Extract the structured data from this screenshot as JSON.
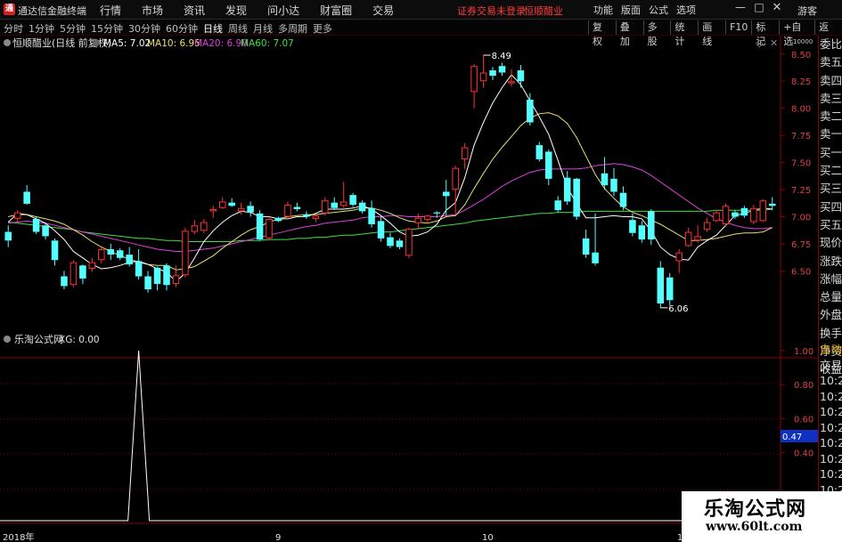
{
  "app": {
    "logo": "通",
    "title": "通达信金融终端",
    "notice": "证券交易未登录",
    "stock_name": "恒顺醋业",
    "guest": "游客"
  },
  "main_menu": [
    "行情",
    "市场",
    "资讯",
    "发现",
    "问小达",
    "财富圈",
    "交易"
  ],
  "right_menu": [
    "功能",
    "版面",
    "公式",
    "选项"
  ],
  "period_tabs": [
    {
      "label": "分时",
      "active": false
    },
    {
      "label": "1分钟",
      "active": false
    },
    {
      "label": "5分钟",
      "active": false
    },
    {
      "label": "15分钟",
      "active": false
    },
    {
      "label": "30分钟",
      "active": false
    },
    {
      "label": "60分钟",
      "active": false
    },
    {
      "label": "日线",
      "active": true
    },
    {
      "label": "周线",
      "active": false
    },
    {
      "label": "月线",
      "active": false
    },
    {
      "label": "多周期",
      "active": false
    },
    {
      "label": "更多",
      "active": false
    }
  ],
  "tool_buttons": [
    "复权",
    "叠加",
    "多股",
    "统计",
    "画线",
    "F10",
    "标记",
    "+自选",
    "返回"
  ],
  "main_panel": {
    "title": "恒顺醋业(日线 前复权)",
    "ma_legend": [
      {
        "label": "MA5: 7.02",
        "color": "#ffffff"
      },
      {
        "label": "MA10: 6.95",
        "color": "#e8e070"
      },
      {
        "label": "MA20: 6.90",
        "color": "#e040e0"
      },
      {
        "label": "MA60: 7.07",
        "color": "#40e040"
      }
    ],
    "y_ticks": [
      "8.50",
      "8.25",
      "8.00",
      "7.75",
      "7.50",
      "7.25",
      "7.00",
      "6.75",
      "6.50"
    ],
    "high_label": "8.49",
    "low_label": "6.06",
    "top_scale": "10000"
  },
  "sub_panel": {
    "title": "乐淘公式网",
    "value_label": "XG: 0.00",
    "y_ticks": [
      "1.00",
      "0.80",
      "0.60",
      "0.40"
    ],
    "cursor_value": "0.47"
  },
  "x_axis": [
    "2018年",
    "9",
    "10",
    "1"
  ],
  "quote_labels": [
    "委比",
    "卖五",
    "卖四",
    "卖三",
    "卖二",
    "卖一",
    "买一",
    "买二",
    "买三",
    "买四",
    "买五",
    "现价",
    "涨跌",
    "涨幅",
    "总量",
    "外盘",
    "换手",
    "净资",
    "收益"
  ],
  "sub_labels": [
    "自动",
    "交易",
    "10:2",
    "10:2",
    "10:2",
    "10:2",
    "10:2",
    "10:2",
    "10:2",
    "10:2",
    "10:2",
    "10:2"
  ],
  "watermark": {
    "title": "乐淘公式网",
    "url": "www.60lt.com"
  },
  "colors": {
    "up": "#ff3232",
    "down": "#54ffff",
    "grid": "#8b0000",
    "ma5": "#ffffff",
    "ma10": "#e8e070",
    "ma20": "#e040e0",
    "ma60": "#40e040",
    "signal": "#ffffff"
  },
  "chart_data": {
    "type": "candlestick",
    "candles": [
      [
        6.86,
        6.92,
        6.72,
        6.78
      ],
      [
        6.98,
        7.06,
        6.94,
        7.04
      ],
      [
        7.23,
        7.29,
        7.11,
        7.12
      ],
      [
        6.98,
        7.0,
        6.84,
        6.86
      ],
      [
        6.92,
        6.94,
        6.79,
        6.82
      ],
      [
        6.78,
        6.8,
        6.55,
        6.6
      ],
      [
        6.45,
        6.5,
        6.33,
        6.36
      ],
      [
        6.37,
        6.6,
        6.35,
        6.58
      ],
      [
        6.55,
        6.56,
        6.38,
        6.43
      ],
      [
        6.52,
        6.62,
        6.49,
        6.58
      ],
      [
        6.6,
        6.72,
        6.57,
        6.7
      ],
      [
        6.7,
        6.75,
        6.6,
        6.65
      ],
      [
        6.69,
        6.71,
        6.6,
        6.62
      ],
      [
        6.65,
        6.72,
        6.54,
        6.56
      ],
      [
        6.59,
        6.7,
        6.42,
        6.45
      ],
      [
        6.45,
        6.5,
        6.3,
        6.33
      ],
      [
        6.53,
        6.54,
        6.32,
        6.38
      ],
      [
        6.55,
        6.57,
        6.32,
        6.37
      ],
      [
        6.38,
        6.55,
        6.35,
        6.46
      ],
      [
        6.46,
        6.9,
        6.44,
        6.87
      ],
      [
        6.86,
        6.97,
        6.84,
        6.92
      ],
      [
        6.87,
        6.98,
        6.85,
        6.95
      ],
      [
        7.05,
        7.1,
        6.99,
        7.07
      ],
      [
        7.08,
        7.18,
        7.07,
        7.14
      ],
      [
        7.13,
        7.17,
        7.09,
        7.1
      ],
      [
        7.05,
        7.13,
        7.02,
        7.08
      ],
      [
        7.1,
        7.14,
        7.0,
        7.04
      ],
      [
        7.03,
        7.06,
        6.78,
        6.79
      ],
      [
        6.8,
        6.99,
        6.78,
        6.98
      ],
      [
        6.99,
        7.0,
        6.95,
        6.96
      ],
      [
        7.0,
        7.14,
        6.98,
        7.11
      ],
      [
        7.09,
        7.13,
        7.05,
        7.07
      ],
      [
        7.02,
        7.05,
        6.98,
        7.0
      ],
      [
        6.98,
        7.02,
        6.95,
        7.01
      ],
      [
        7.03,
        7.18,
        7.01,
        7.15
      ],
      [
        7.13,
        7.18,
        7.06,
        7.08
      ],
      [
        7.1,
        7.32,
        7.08,
        7.14
      ],
      [
        7.2,
        7.22,
        7.09,
        7.11
      ],
      [
        7.13,
        7.15,
        7.03,
        7.05
      ],
      [
        7.08,
        7.15,
        6.9,
        6.93
      ],
      [
        6.96,
        7.0,
        6.77,
        6.8
      ],
      [
        6.81,
        6.85,
        6.71,
        6.73
      ],
      [
        6.78,
        6.8,
        6.7,
        6.72
      ],
      [
        6.64,
        6.9,
        6.62,
        6.89
      ],
      [
        6.94,
        7.03,
        6.88,
        6.99
      ],
      [
        6.97,
        7.02,
        6.95,
        7.01
      ],
      [
        7.04,
        7.05,
        6.99,
        7.03
      ],
      [
        7.23,
        7.34,
        7.01,
        7.19
      ],
      [
        7.25,
        7.47,
        7.03,
        7.45
      ],
      [
        7.53,
        7.68,
        7.44,
        7.64
      ],
      [
        8.15,
        8.41,
        8.0,
        8.39
      ],
      [
        8.25,
        8.49,
        8.19,
        8.33
      ],
      [
        8.35,
        8.38,
        8.26,
        8.3
      ],
      [
        8.39,
        8.42,
        8.3,
        8.33
      ],
      [
        8.23,
        8.36,
        8.2,
        8.25
      ],
      [
        8.35,
        8.4,
        8.19,
        8.25
      ],
      [
        8.08,
        8.14,
        7.84,
        7.87
      ],
      [
        7.66,
        7.69,
        7.51,
        7.53
      ],
      [
        7.6,
        7.62,
        7.29,
        7.35
      ],
      [
        7.15,
        7.19,
        7.04,
        7.06
      ],
      [
        7.36,
        7.42,
        7.11,
        7.14
      ],
      [
        7.35,
        7.36,
        6.97,
        7.0
      ],
      [
        6.8,
        6.88,
        6.62,
        6.65
      ],
      [
        6.67,
        7.03,
        6.55,
        6.57
      ],
      [
        7.4,
        7.55,
        7.25,
        7.29
      ],
      [
        7.35,
        7.45,
        7.19,
        7.23
      ],
      [
        7.22,
        7.28,
        7.06,
        7.09
      ],
      [
        6.97,
        7.03,
        6.82,
        6.85
      ],
      [
        6.92,
        6.96,
        6.76,
        6.79
      ],
      [
        7.05,
        7.07,
        6.74,
        6.79
      ],
      [
        6.53,
        6.59,
        6.16,
        6.2
      ],
      [
        6.44,
        6.48,
        6.18,
        6.23
      ],
      [
        6.59,
        6.7,
        6.48,
        6.67
      ],
      [
        6.73,
        6.9,
        6.72,
        6.86
      ],
      [
        6.78,
        6.92,
        6.76,
        6.82
      ],
      [
        6.88,
        6.99,
        6.86,
        6.95
      ],
      [
        6.96,
        7.06,
        6.95,
        7.04
      ],
      [
        6.93,
        7.12,
        6.91,
        7.1
      ],
      [
        7.04,
        7.06,
        6.98,
        7.0
      ],
      [
        7.08,
        7.1,
        6.99,
        7.01
      ],
      [
        6.95,
        7.11,
        6.93,
        7.08
      ],
      [
        6.96,
        7.16,
        6.95,
        7.15
      ],
      [
        7.12,
        7.18,
        7.06,
        7.1
      ]
    ],
    "ma5": [
      6.95,
      7.03,
      7.02,
      6.98,
      6.94,
      6.87,
      6.79,
      6.68,
      6.62,
      6.56,
      6.52,
      6.53,
      6.55,
      6.58,
      6.59,
      6.56,
      6.52,
      6.49,
      6.4,
      6.48,
      6.62,
      6.77,
      6.87,
      6.95,
      7.01,
      7.05,
      7.04,
      7.0,
      7.0,
      6.98,
      6.98,
      7.0,
      7.0,
      7.03,
      7.07,
      7.07,
      7.07,
      7.08,
      7.1,
      7.07,
      7.01,
      6.94,
      6.86,
      6.82,
      6.83,
      6.86,
      6.93,
      7.06,
      7.13,
      7.36,
      7.66,
      7.87,
      8.05,
      8.19,
      8.31,
      8.22,
      8.07,
      7.92,
      7.76,
      7.52,
      7.27,
      7.12,
      6.99,
      6.99,
      7.0,
      7.01,
      7.0,
      7.0,
      6.98,
      6.87,
      6.72,
      6.65,
      6.61,
      6.6,
      6.72,
      6.78,
      6.83,
      6.92,
      7.01,
      7.03,
      7.06,
      7.08,
      7.07
    ],
    "ma10": [
      7.0,
      7.02,
      7.02,
      7.0,
      6.98,
      6.96,
      6.93,
      6.88,
      6.83,
      6.77,
      6.72,
      6.68,
      6.64,
      6.61,
      6.58,
      6.56,
      6.55,
      6.55,
      6.51,
      6.52,
      6.54,
      6.59,
      6.64,
      6.71,
      6.77,
      6.83,
      6.88,
      6.91,
      6.95,
      6.98,
      7.0,
      7.01,
      7.02,
      7.02,
      7.03,
      7.04,
      7.05,
      7.06,
      7.08,
      7.08,
      7.06,
      7.03,
      6.99,
      6.96,
      6.95,
      6.94,
      6.96,
      7.0,
      7.01,
      7.11,
      7.26,
      7.4,
      7.53,
      7.64,
      7.74,
      7.84,
      7.91,
      7.95,
      7.96,
      7.93,
      7.86,
      7.73,
      7.56,
      7.39,
      7.26,
      7.17,
      7.09,
      7.04,
      7.01,
      6.97,
      6.93,
      6.88,
      6.83,
      6.78,
      6.78,
      6.79,
      6.8,
      6.82,
      6.84,
      6.85,
      6.85,
      6.86,
      6.9
    ],
    "ma20": [
      6.94,
      6.95,
      6.96,
      6.95,
      6.94,
      6.92,
      6.9,
      6.88,
      6.86,
      6.84,
      6.82,
      6.8,
      6.78,
      6.76,
      6.74,
      6.72,
      6.7,
      6.69,
      6.68,
      6.68,
      6.69,
      6.7,
      6.71,
      6.73,
      6.75,
      6.77,
      6.79,
      6.81,
      6.83,
      6.85,
      6.87,
      6.89,
      6.91,
      6.92,
      6.94,
      6.95,
      6.96,
      6.97,
      6.99,
      7.0,
      7.0,
      7.01,
      7.01,
      7.0,
      7.0,
      7.0,
      7.0,
      7.01,
      7.02,
      7.06,
      7.11,
      7.16,
      7.22,
      7.28,
      7.33,
      7.37,
      7.41,
      7.43,
      7.44,
      7.44,
      7.44,
      7.44,
      7.45,
      7.47,
      7.48,
      7.49,
      7.48,
      7.46,
      7.43,
      7.38,
      7.32,
      7.26,
      7.2,
      7.14,
      7.08,
      7.03,
      6.98,
      6.95,
      6.92,
      6.9,
      6.89,
      6.89,
      6.9
    ],
    "ma60": [
      6.95,
      6.94,
      6.93,
      6.92,
      6.91,
      6.9,
      6.89,
      6.88,
      6.86,
      6.85,
      6.84,
      6.83,
      6.82,
      6.81,
      6.8,
      6.8,
      6.79,
      6.78,
      6.78,
      6.77,
      6.77,
      6.77,
      6.77,
      6.77,
      6.77,
      6.78,
      6.78,
      6.78,
      6.79,
      6.79,
      6.79,
      6.8,
      6.8,
      6.81,
      6.81,
      6.82,
      6.83,
      6.83,
      6.84,
      6.85,
      6.86,
      6.86,
      6.87,
      6.88,
      6.89,
      6.9,
      6.91,
      6.92,
      6.93,
      6.94,
      6.96,
      6.97,
      6.98,
      6.99,
      7.0,
      7.01,
      7.02,
      7.03,
      7.03,
      7.04,
      7.04,
      7.04,
      7.05,
      7.05,
      7.05,
      7.05,
      7.05,
      7.05,
      7.05,
      7.05,
      7.05,
      7.05,
      7.05,
      7.05,
      7.05,
      7.05,
      7.06,
      7.06,
      7.06,
      7.06,
      7.06,
      7.06,
      7.07
    ],
    "xg_signal": {
      "offset_days": -7,
      "spike_index": 15,
      "length": 90
    },
    "ylim": [
      6.0,
      8.6
    ]
  }
}
